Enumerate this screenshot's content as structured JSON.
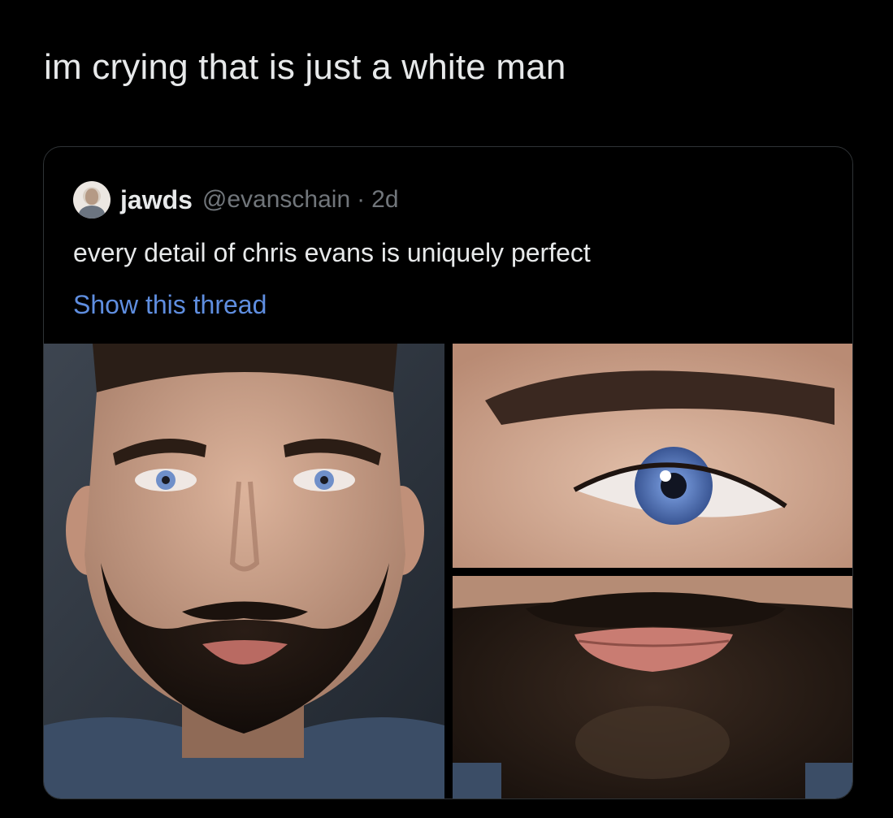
{
  "tweet": {
    "text": "im crying that is just a white man"
  },
  "quote": {
    "display_name": "jawds",
    "handle": "@evanschain",
    "separator": "·",
    "time": "2d",
    "text": "every detail of chris evans is uniquely perfect",
    "show_thread": "Show this thread"
  },
  "colors": {
    "background": "#000000",
    "text": "#e7e9ea",
    "secondary": "#71767b",
    "link": "#5f8ee0",
    "border": "#2f3336"
  }
}
